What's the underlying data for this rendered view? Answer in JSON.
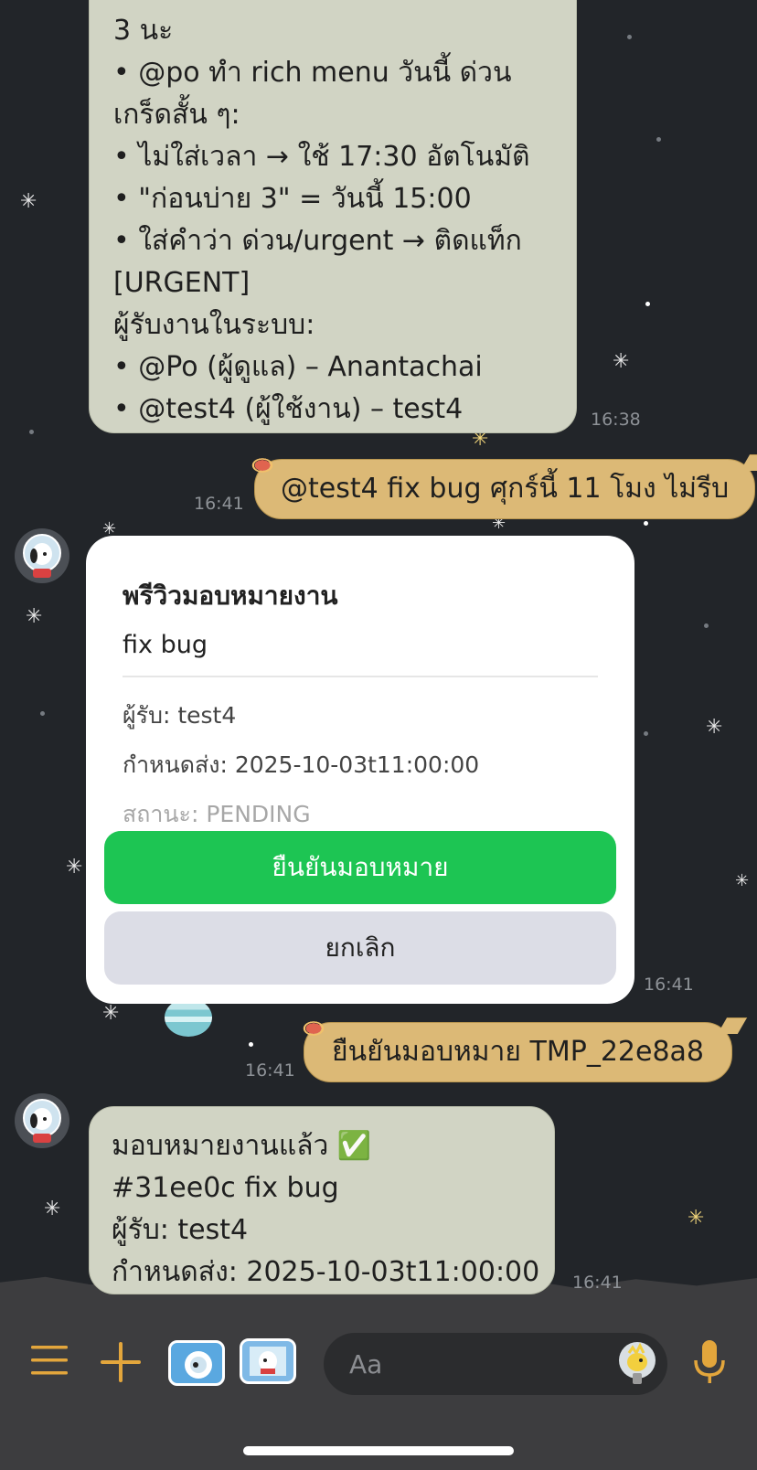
{
  "chat": {
    "message1": {
      "lines": [
        "3 นะ",
        "• @po ทำ rich menu วันนี้ ด่วน",
        "เกร็ดสั้น ๆ:",
        "• ไม่ใส่เวลา → ใช้ 17:30 อัตโนมัติ",
        "• \"ก่อนบ่าย 3\" = วันนี้ 15:00",
        "• ใส่คำว่า ด่วน/urgent → ติดแท็ก",
        "[URGENT]",
        "ผู้รับงานในระบบ:",
        "• @Po (ผู้ดูแล) – Anantachai",
        "• @test4 (ผู้ใช้งาน) – test4"
      ],
      "time": "16:38"
    },
    "outgoing1": {
      "text": "@test4 fix bug ศุกร์นี้ 11 โมง ไม่รีบ",
      "time": "16:41"
    },
    "card": {
      "title": "พรีวิวมอบหมายงาน",
      "task": "fix bug",
      "assignee": "ผู้รับ: test4",
      "due": "กำหนดส่ง: 2025-10-03t11:00:00",
      "status": "สถานะ: PENDING",
      "confirm_label": "ยืนยันมอบหมาย",
      "cancel_label": "ยกเลิก",
      "time": "16:41"
    },
    "outgoing2": {
      "text": "ยืนยันมอบหมาย TMP_22e8a8",
      "time": "16:41"
    },
    "message2": {
      "lines": [
        "มอบหมายงานแล้ว ✅",
        "#31ee0c fix bug",
        "ผู้รับ: test4",
        "กำหนดส่ง: 2025-10-03t11:00:00"
      ],
      "time": "16:41"
    }
  },
  "input": {
    "placeholder": "Aa"
  },
  "colors": {
    "background": "#222529",
    "incoming_bubble": "#d1d4c4",
    "outgoing_bubble": "#dcb976",
    "confirm_button": "#1dc553",
    "cancel_button": "#dcdde6",
    "toolbar_icon": "#e3a63c"
  },
  "icons": [
    "menu-icon",
    "plus-icon",
    "camera-sticker-icon",
    "photo-sticker-icon",
    "sticker-icon",
    "microphone-icon"
  ]
}
